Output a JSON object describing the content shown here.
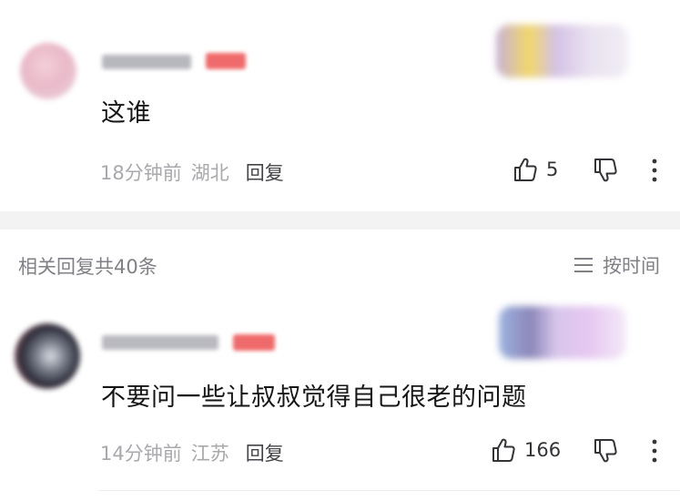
{
  "comments": [
    {
      "text": "这谁",
      "time": "18分钟前",
      "location": "湖北",
      "reply_label": "回复",
      "likes": "5"
    },
    {
      "text": "不要问一些让叔叔觉得自己很老的问题",
      "time": "14分钟前",
      "location": "江苏",
      "reply_label": "回复",
      "likes": "166"
    }
  ],
  "section": {
    "title": "相关回复共40条",
    "sort_label": "按时间",
    "sort_icon": "list-icon"
  },
  "icons": {
    "like": "thumbs-up-icon",
    "dislike": "thumbs-down-icon",
    "more": "more-vertical-icon"
  },
  "colors": {
    "primary_text": "#161616",
    "secondary_text": "#a8a8ad",
    "badge": "#ef6b6b",
    "divider": "#f3f3f4"
  }
}
